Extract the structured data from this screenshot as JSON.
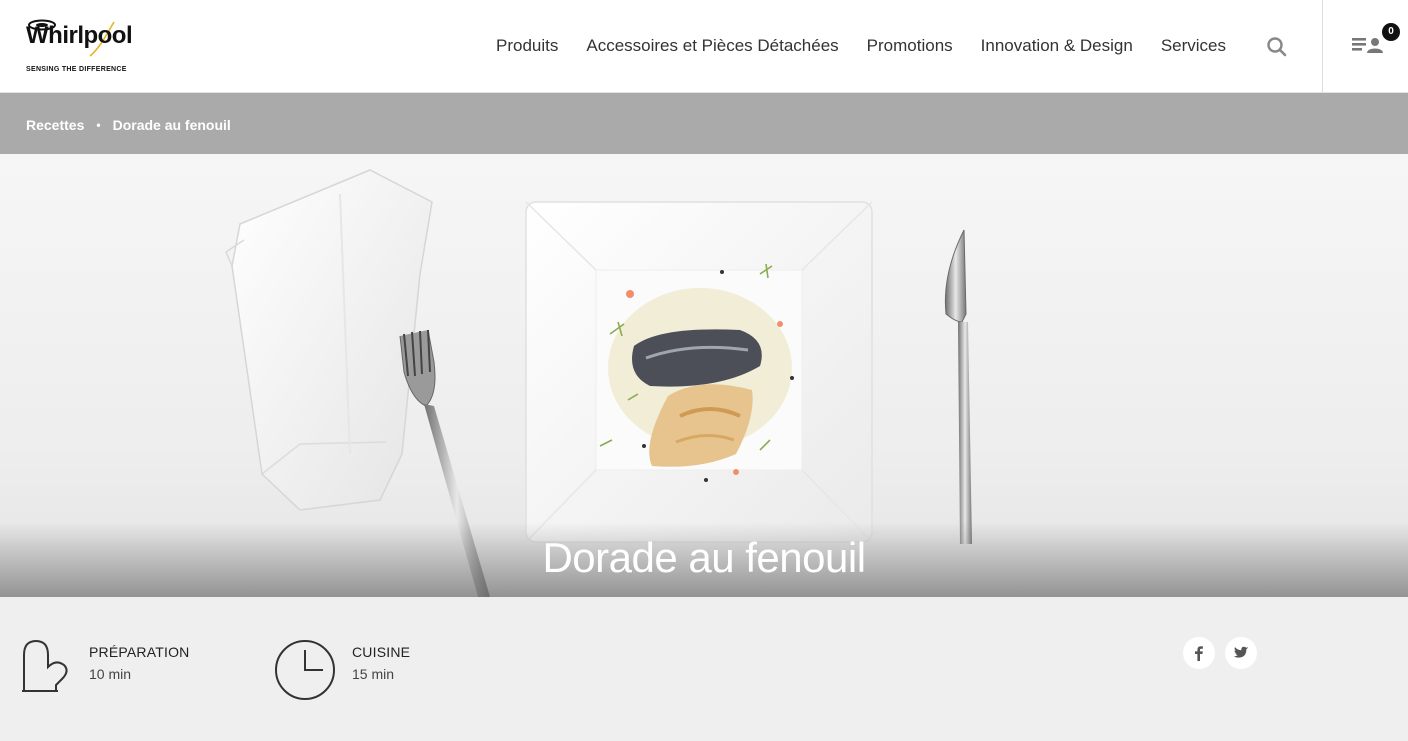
{
  "brand": {
    "name": "Whirlpool",
    "tagline": "SENSING THE DIFFERENCE"
  },
  "nav": {
    "items": [
      {
        "label": "Produits"
      },
      {
        "label": "Accessoires et Pièces Détachées"
      },
      {
        "label": "Promotions"
      },
      {
        "label": "Innovation & Design"
      },
      {
        "label": "Services"
      }
    ],
    "search_icon": "search-icon",
    "compare_icon": "compare-list-icon",
    "compare_count": "0"
  },
  "breadcrumb": {
    "items": [
      {
        "label": "Recettes"
      },
      {
        "label": "Dorade au fenouil"
      }
    ],
    "separator": "•"
  },
  "hero": {
    "title": "Dorade au fenouil"
  },
  "recipe_info": {
    "preparation": {
      "label": "Préparation",
      "value": "10 min",
      "icon": "oven-mitt-icon"
    },
    "cooking": {
      "label": "Cuisine",
      "value": "15 min",
      "icon": "clock-icon"
    }
  },
  "social": {
    "facebook_icon": "facebook-icon",
    "twitter_icon": "twitter-icon"
  },
  "colors": {
    "breadcrumb_bg": "#aaaaaa",
    "info_bg": "#efefef",
    "text": "#333333"
  }
}
